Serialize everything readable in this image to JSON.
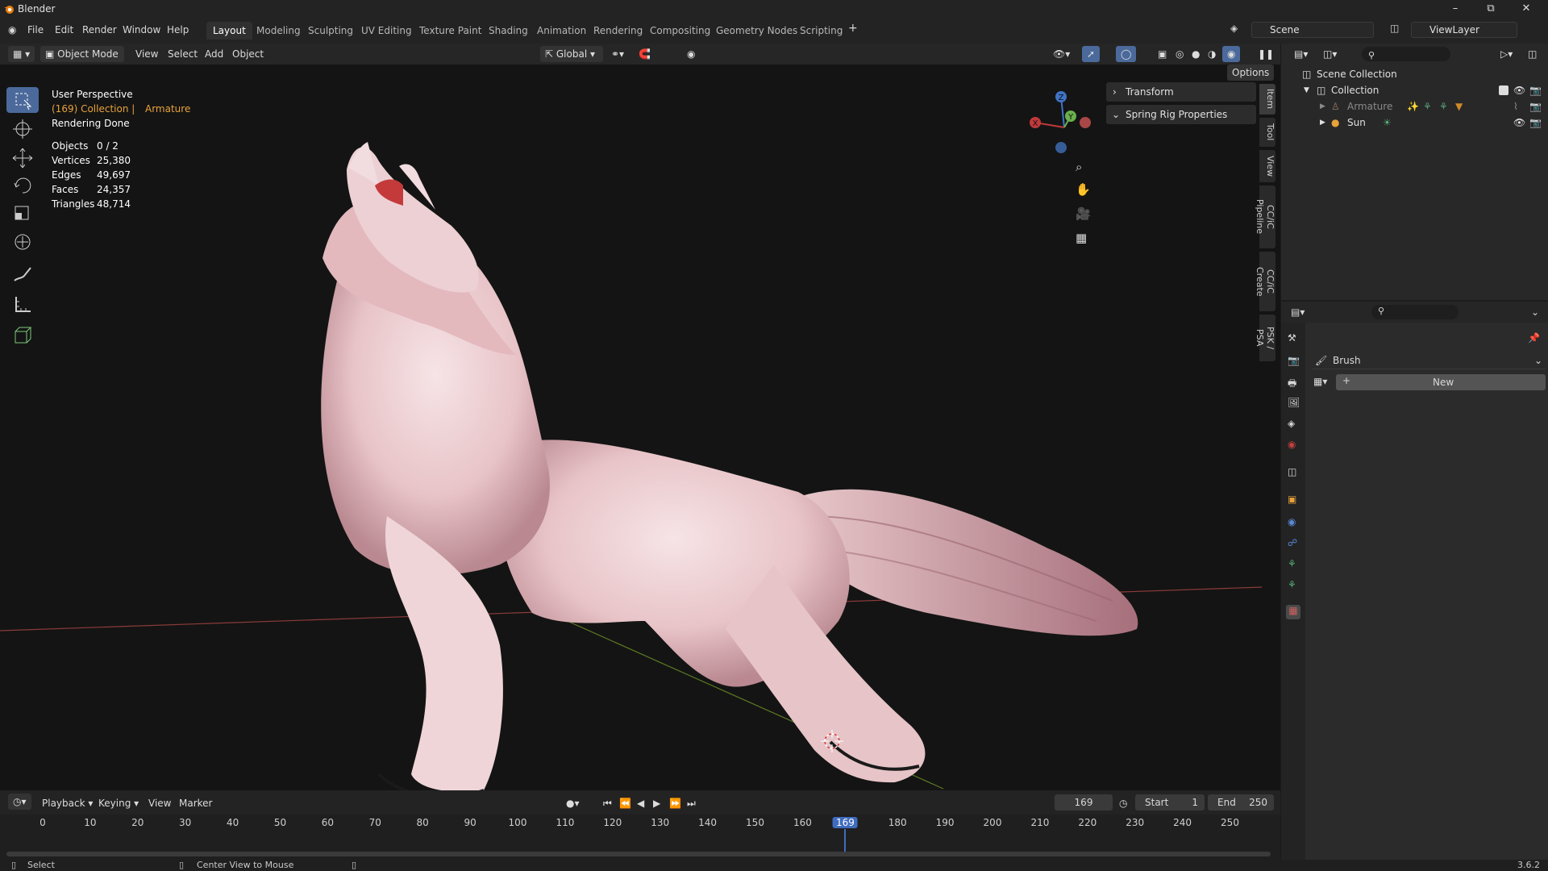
{
  "app": {
    "title": "Blender",
    "version": "3.6.2"
  },
  "menu": [
    "File",
    "Edit",
    "Render",
    "Window",
    "Help"
  ],
  "workspaces": [
    "Layout",
    "Modeling",
    "Sculpting",
    "UV Editing",
    "Texture Paint",
    "Shading",
    "Animation",
    "Rendering",
    "Compositing",
    "Geometry Nodes",
    "Scripting"
  ],
  "active_workspace": "Layout",
  "scene": {
    "label": "Scene",
    "view_layer": "ViewLayer"
  },
  "viewport_header": {
    "mode": "Object Mode",
    "menus": [
      "View",
      "Select",
      "Add",
      "Object"
    ],
    "orientation": "Global",
    "options": "Options"
  },
  "overlay_info": {
    "perspective": "User Perspective",
    "collection_line_a": "(169) Collection |",
    "collection_line_b": "Armature",
    "render_status": "Rendering Done",
    "stats": [
      {
        "label": "Objects",
        "value": "0 / 2"
      },
      {
        "label": "Vertices",
        "value": "25,380"
      },
      {
        "label": "Edges",
        "value": "49,697"
      },
      {
        "label": "Faces",
        "value": "24,357"
      },
      {
        "label": "Triangles",
        "value": "48,714"
      }
    ]
  },
  "gizmo": {
    "z": "Z",
    "y": "Y",
    "x": "X"
  },
  "npanel": {
    "panels": [
      "Transform",
      "Spring Rig Properties"
    ],
    "tabs": [
      "Item",
      "Tool",
      "View",
      "CC/iC Pipeline",
      "CC/iC Create",
      "PSK / PSA"
    ]
  },
  "outliner": {
    "root": "Scene Collection",
    "collection": "Collection",
    "items": [
      "Armature",
      "Sun"
    ]
  },
  "properties": {
    "brush_label": "Brush",
    "new_button": "New"
  },
  "timeline": {
    "menus": [
      "Playback",
      "Keying",
      "View",
      "Marker"
    ],
    "current_frame": "169",
    "start_label": "Start",
    "start": "1",
    "end_label": "End",
    "end": "250",
    "ticks": [
      "0",
      "10",
      "20",
      "30",
      "40",
      "50",
      "60",
      "70",
      "80",
      "90",
      "100",
      "110",
      "120",
      "130",
      "140",
      "150",
      "160",
      "169",
      "180",
      "190",
      "200",
      "210",
      "220",
      "230",
      "240",
      "250"
    ]
  },
  "status": {
    "left": "Select",
    "middle": "Center View to Mouse"
  },
  "colors": {
    "accent": "#4b6a9b",
    "current_frame": "#3f6cbf",
    "orange": "#e8a23a"
  }
}
